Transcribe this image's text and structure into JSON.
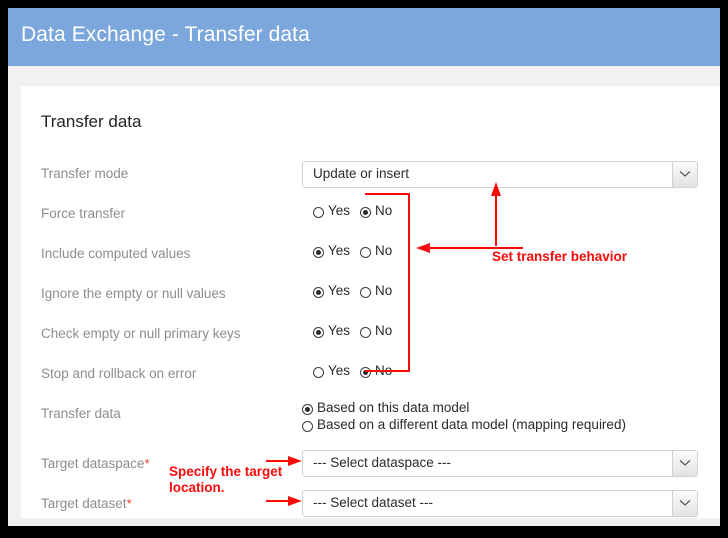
{
  "window": {
    "header_title": "Data Exchange - Transfer data",
    "header_color": "#7ba7dc"
  },
  "card": {
    "section_title": "Transfer data"
  },
  "form": {
    "rows": [
      {
        "name": "transfer-mode",
        "label": "Transfer mode",
        "type": "select",
        "value": "Update or insert"
      },
      {
        "name": "force-transfer",
        "label": "Force transfer",
        "type": "radio-yesno",
        "yes_label": "Yes",
        "no_label": "No",
        "selected": "No"
      },
      {
        "name": "include-computed-values",
        "label": "Include computed values",
        "type": "radio-yesno",
        "yes_label": "Yes",
        "no_label": "No",
        "selected": "Yes"
      },
      {
        "name": "ignore-empty-null-values",
        "label": "Ignore the empty or null values",
        "type": "radio-yesno",
        "yes_label": "Yes",
        "no_label": "No",
        "selected": "Yes"
      },
      {
        "name": "check-empty-null-primary-keys",
        "label": "Check empty or null primary keys",
        "type": "radio-yesno",
        "yes_label": "Yes",
        "no_label": "No",
        "selected": "Yes"
      },
      {
        "name": "stop-rollback-on-error",
        "label": "Stop and rollback on error",
        "type": "radio-yesno",
        "yes_label": "Yes",
        "no_label": "No",
        "selected": "No"
      },
      {
        "name": "transfer-data-model",
        "label": "Transfer data",
        "type": "radio-stack",
        "options": [
          "Based on this data model",
          "Based on a different data model (mapping required)"
        ],
        "selected_index": 0
      },
      {
        "name": "target-dataspace",
        "label": "Target dataspace",
        "required_marker": "*",
        "type": "select",
        "value": "--- Select dataspace ---"
      },
      {
        "name": "target-dataset",
        "label": "Target dataset",
        "required_marker": "*",
        "type": "select",
        "value": "--- Select dataset ---"
      }
    ]
  },
  "annotations": {
    "color": "#fb0a0a",
    "set_transfer_behavior": "Set transfer behavior",
    "specify_target_line1": "Specify the target",
    "specify_target_line2": "location."
  }
}
